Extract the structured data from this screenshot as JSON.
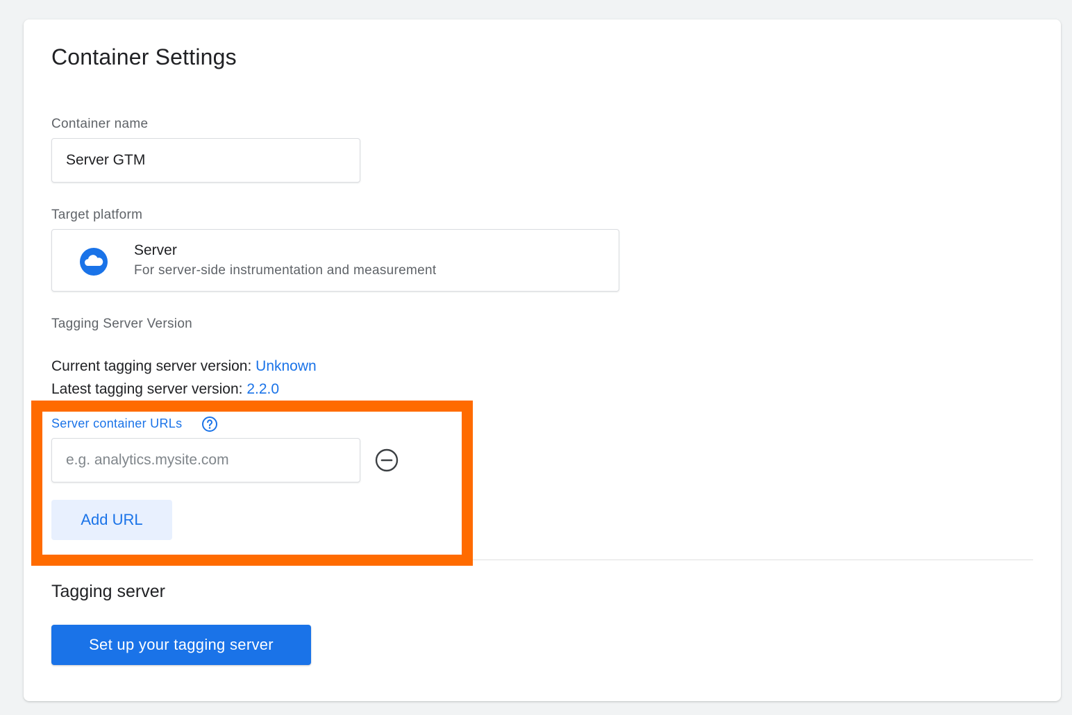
{
  "page": {
    "title": "Container Settings"
  },
  "container_name": {
    "label": "Container name",
    "value": "Server GTM"
  },
  "target_platform": {
    "label": "Target platform",
    "name": "Server",
    "description": "For server-side instrumentation and measurement",
    "icon": "cloud-icon"
  },
  "tagging_server_version": {
    "label": "Tagging Server Version",
    "current_label": "Current tagging server version:",
    "current_value": "Unknown",
    "latest_label": "Latest tagging server version:",
    "latest_value": "2.2.0"
  },
  "server_container_urls": {
    "label": "Server container URLs",
    "help_icon": "help-circle-icon",
    "placeholder": "e.g. analytics.mysite.com",
    "value": "",
    "remove_icon": "remove-circle-icon",
    "add_button_label": "Add URL"
  },
  "tagging_server": {
    "heading": "Tagging server",
    "button_label": "Set up your tagging server"
  },
  "colors": {
    "accent": "#1a73e8",
    "highlight": "#ff6b00",
    "background": "#f1f3f4"
  }
}
